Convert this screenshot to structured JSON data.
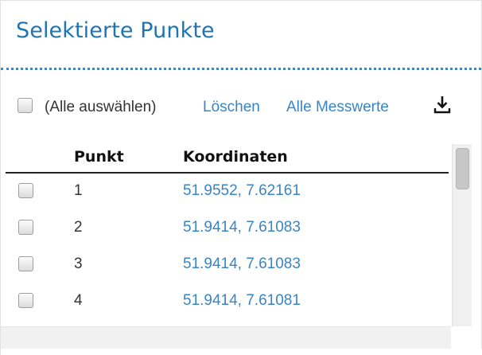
{
  "panel": {
    "title": "Selektierte Punkte"
  },
  "toolbar": {
    "select_all_label": "(Alle auswählen)",
    "delete_label": "Löschen",
    "all_measurements_label": "Alle Messwerte",
    "download_icon": "download-icon"
  },
  "table": {
    "columns": [
      "Punkt",
      "Koordinaten"
    ],
    "rows": [
      {
        "punkt": "1",
        "koordinaten": "51.9552, 7.62161"
      },
      {
        "punkt": "2",
        "koordinaten": "51.9414, 7.61083"
      },
      {
        "punkt": "3",
        "koordinaten": "51.9414, 7.61083"
      },
      {
        "punkt": "4",
        "koordinaten": "51.9414, 7.61081"
      }
    ]
  },
  "colors": {
    "title": "#1f75b3",
    "link": "#3a84c4",
    "divider": "#2f8ccf"
  }
}
